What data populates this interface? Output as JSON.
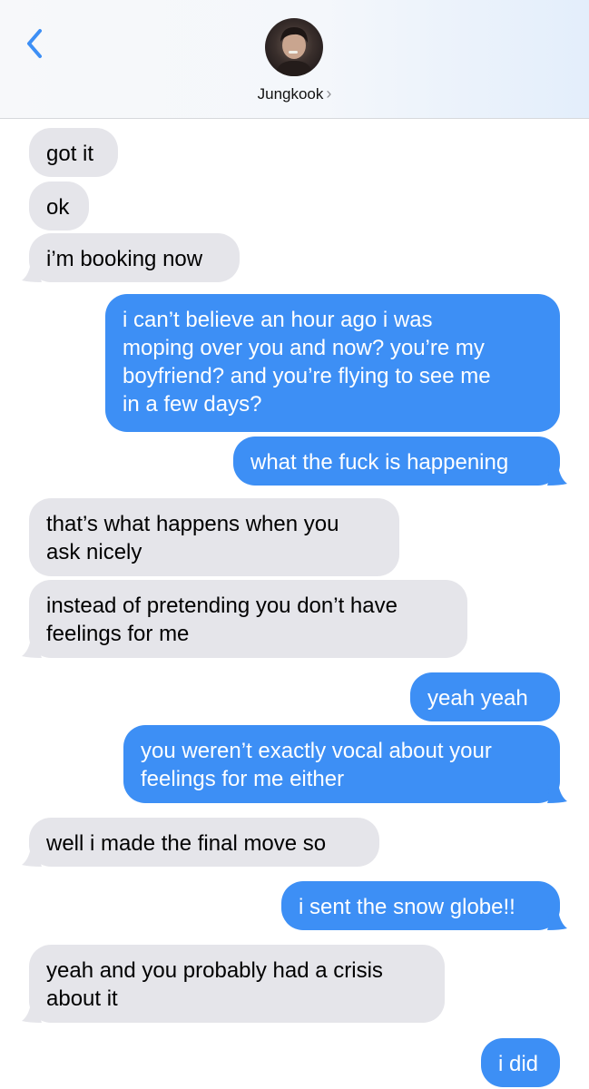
{
  "header": {
    "contact_name": "Jungkook",
    "chevron": "›",
    "back_icon": "chevron-left-icon",
    "accent_color": "#3d8ff5"
  },
  "messages": [
    {
      "id": 1,
      "from": "them",
      "lines": [
        "got it"
      ]
    },
    {
      "id": 2,
      "from": "them",
      "lines": [
        "ok"
      ]
    },
    {
      "id": 3,
      "from": "them",
      "lines": [
        "i’m booking now"
      ]
    },
    {
      "id": 4,
      "from": "me",
      "lines": [
        "i can’t believe an hour ago i was",
        "moping over you and now? you’re my",
        "boyfriend? and you’re flying to see me",
        "in a few days?"
      ]
    },
    {
      "id": 5,
      "from": "me",
      "lines": [
        "what the fuck is happening"
      ]
    },
    {
      "id": 6,
      "from": "them",
      "lines": [
        "that’s what happens when you",
        "ask nicely"
      ]
    },
    {
      "id": 7,
      "from": "them",
      "lines": [
        "instead of pretending you don’t have",
        "feelings for me"
      ]
    },
    {
      "id": 8,
      "from": "me",
      "lines": [
        "yeah yeah"
      ]
    },
    {
      "id": 9,
      "from": "me",
      "lines": [
        "you weren’t exactly vocal about your",
        "feelings for me either"
      ]
    },
    {
      "id": 10,
      "from": "them",
      "lines": [
        "well i made the final move so"
      ]
    },
    {
      "id": 11,
      "from": "me",
      "lines": [
        "i sent the snow globe!!"
      ]
    },
    {
      "id": 12,
      "from": "them",
      "lines": [
        "yeah and you probably had a crisis",
        "about it"
      ]
    },
    {
      "id": 13,
      "from": "me",
      "lines": [
        "i did"
      ]
    }
  ],
  "colors": {
    "incoming_bubble": "#e5e5ea",
    "outgoing_bubble": "#3d8ff5"
  }
}
